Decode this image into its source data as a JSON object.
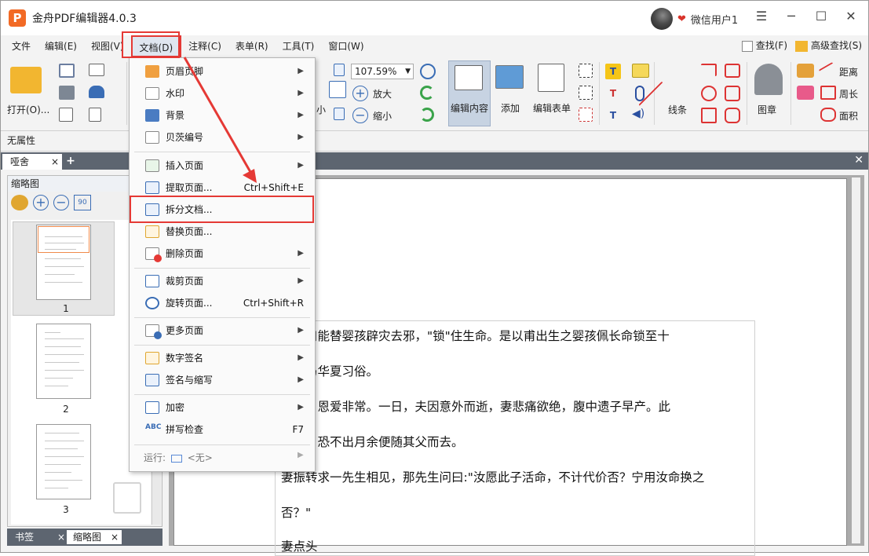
{
  "app": {
    "title": "金舟PDF编辑器4.0.3",
    "logo_letter": "P",
    "user": "微信用户1",
    "window_buttons": [
      "☰",
      "─",
      "☐",
      "✕"
    ]
  },
  "menubar": {
    "items": [
      "文件",
      "编辑(E)",
      "视图(V)",
      "文档(D)",
      "注释(C)",
      "表单(R)",
      "工具(T)",
      "窗口(W)"
    ],
    "right": [
      "查找(F)",
      "高级查找(S)"
    ]
  },
  "ribbon": {
    "open_label": "打开(O)...",
    "zoom_value": "107.59%",
    "zoom_in": "放大",
    "zoom_out": "缩小",
    "partial_label": "小",
    "edit_content": "编辑内容",
    "add": "添加",
    "edit_form": "编辑表单",
    "lines": "线条",
    "stamp": "图章",
    "distance": "距离",
    "perimeter": "周长",
    "area": "面积"
  },
  "propbar": {
    "label": "无属性"
  },
  "tabs": {
    "doc_tab": "哑舍",
    "close": "×",
    "add": "+",
    "close_all": "✕"
  },
  "left_panel": {
    "title": "缩略图",
    "page_numbers": [
      "1",
      "2",
      "3"
    ],
    "bottom_tabs": [
      "书签",
      "缩略图"
    ]
  },
  "document": {
    "lines": [
      "，传曰能替婴孩辟灾去邪，\"锁\"住生命。是以甫出生之婴孩佩长命锁至十",
      "止，乃华夏习俗。",
      "二人，恩爱非常。一日，夫因意外而逝，妻悲痛欲绝，腹中遗子早产。此",
      "气若，恐不出月余便随其父而去。",
      "妻振转求一先生相见，那先生问曰:\"汝愿此子活命，不计代价否？宁用汝命换之",
      "否？\"",
      "妻点头"
    ]
  },
  "dropdown": {
    "items": [
      {
        "label": "页眉页脚",
        "shortcut": "",
        "arrow": "▶"
      },
      {
        "label": "水印",
        "shortcut": "",
        "arrow": "▶"
      },
      {
        "label": "背景",
        "shortcut": "",
        "arrow": "▶"
      },
      {
        "label": "贝茨编号",
        "shortcut": "",
        "arrow": "▶"
      },
      {
        "label": "插入页面",
        "shortcut": "",
        "arrow": "▶"
      },
      {
        "label": "提取页面...",
        "shortcut": "Ctrl+Shift+E",
        "arrow": ""
      },
      {
        "label": "拆分文档...",
        "shortcut": "",
        "arrow": ""
      },
      {
        "label": "替换页面...",
        "shortcut": "",
        "arrow": ""
      },
      {
        "label": "删除页面",
        "shortcut": "",
        "arrow": "▶"
      },
      {
        "label": "裁剪页面",
        "shortcut": "",
        "arrow": "▶"
      },
      {
        "label": "旋转页面...",
        "shortcut": "Ctrl+Shift+R",
        "arrow": ""
      },
      {
        "label": "更多页面",
        "shortcut": "",
        "arrow": "▶"
      },
      {
        "label": "数字签名",
        "shortcut": "",
        "arrow": "▶"
      },
      {
        "label": "签名与缩写",
        "shortcut": "",
        "arrow": "▶"
      },
      {
        "label": "加密",
        "shortcut": "",
        "arrow": "▶"
      },
      {
        "label": "拼写检查",
        "shortcut": "F7",
        "arrow": ""
      }
    ],
    "run_prefix": "运行:",
    "run_value": "<无>",
    "run_arrow": "▶"
  },
  "colors": {
    "highlight": "#e53935",
    "accent": "#3a6db5",
    "logo": "#f26a25"
  }
}
